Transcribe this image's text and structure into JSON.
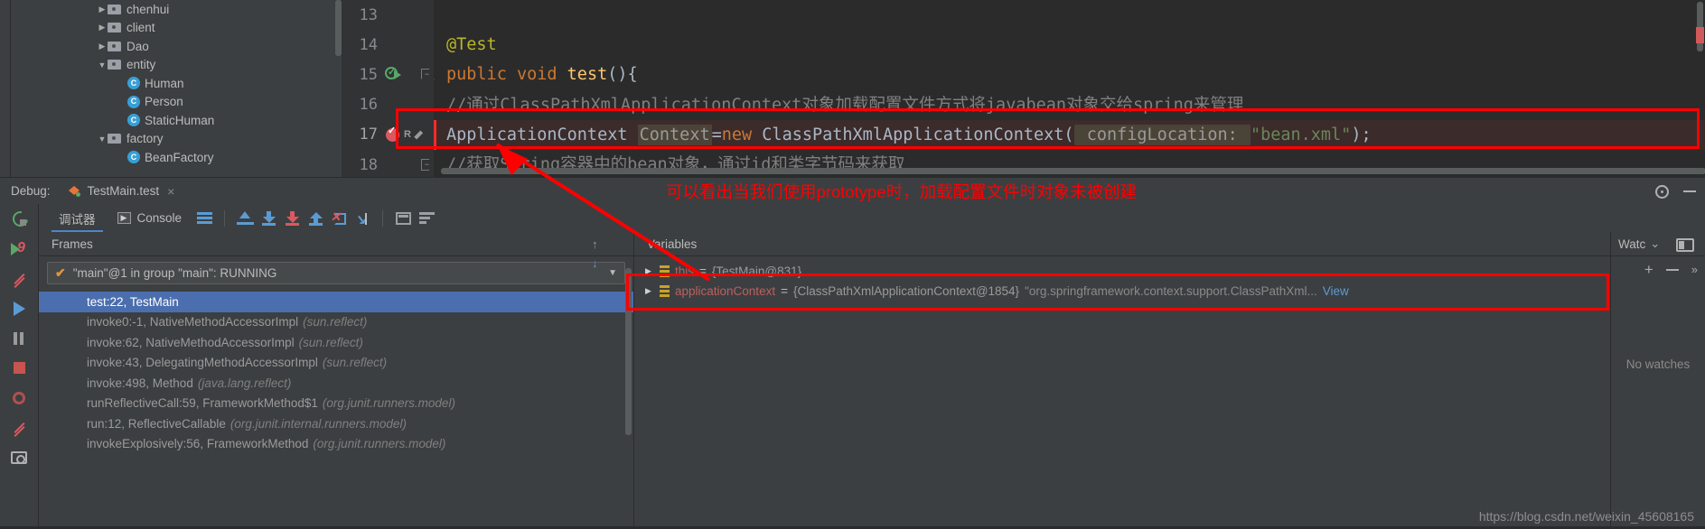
{
  "project_tree": {
    "items": [
      {
        "label": "chenhui",
        "type": "folder",
        "expanded": false,
        "indent": 0
      },
      {
        "label": "client",
        "type": "folder",
        "expanded": false,
        "indent": 0
      },
      {
        "label": "Dao",
        "type": "folder",
        "expanded": false,
        "indent": 0
      },
      {
        "label": "entity",
        "type": "folder",
        "expanded": true,
        "indent": 0
      },
      {
        "label": "Human",
        "type": "class",
        "expanded": null,
        "indent": 1
      },
      {
        "label": "Person",
        "type": "class",
        "expanded": null,
        "indent": 1
      },
      {
        "label": "StaticHuman",
        "type": "class",
        "expanded": null,
        "indent": 1
      },
      {
        "label": "factory",
        "type": "folder",
        "expanded": true,
        "indent": 0
      },
      {
        "label": "BeanFactory",
        "type": "class",
        "expanded": null,
        "indent": 1
      }
    ]
  },
  "editor": {
    "lines": [
      {
        "num": "13",
        "tokens": []
      },
      {
        "num": "14",
        "tokens": [
          {
            "t": "@Test",
            "c": "t-ann"
          }
        ]
      },
      {
        "num": "15",
        "tokens": [
          {
            "t": "public ",
            "c": "t-kw"
          },
          {
            "t": "void ",
            "c": "t-kw"
          },
          {
            "t": "test",
            "c": "t-method"
          },
          {
            "t": "(){",
            "c": "t-plain"
          }
        ]
      },
      {
        "num": "16",
        "tokens": [
          {
            "t": "    //通过ClassPathXmlApplicationContext对象加载配置文件方式将javabean对象交给spring来管理",
            "c": "t-comment"
          }
        ]
      },
      {
        "num": "17",
        "tokens": [
          {
            "t": "    ApplicationContext ",
            "c": "t-type"
          },
          {
            "t": "Context",
            "c": "t-ctxvar"
          },
          {
            "t": "=",
            "c": "t-plain"
          },
          {
            "t": "new ",
            "c": "t-kw"
          },
          {
            "t": "ClassPathXmlApplicationContext(",
            "c": "t-type"
          },
          {
            "t": " configLocation: ",
            "c": "t-param"
          },
          {
            "t": "\"bean.xml\"",
            "c": "t-str"
          },
          {
            "t": ");",
            "c": "t-plain"
          }
        ]
      },
      {
        "num": "18",
        "tokens": [
          {
            "t": "    //获取Spring容器中的bean对象，通过id和类字节码来获取",
            "c": "t-comment"
          }
        ]
      }
    ],
    "line15_gutter": "run-icon",
    "line17_gutter": "breakpoint-icon"
  },
  "debug_header": {
    "label": "Debug:",
    "tab_name": "TestMain.test",
    "close_glyph": "×"
  },
  "debug_toolbar": {
    "tabs": [
      {
        "label": "调试器",
        "active": true
      },
      {
        "label": "Console",
        "active": false
      }
    ]
  },
  "frames_panel": {
    "title": "Frames",
    "thread": "\"main\"@1 in group \"main\": RUNNING",
    "rows": [
      {
        "frame": "test:22, TestMain",
        "pkg": "",
        "selected": true
      },
      {
        "frame": "invoke0:-1, NativeMethodAccessorImpl",
        "pkg": "(sun.reflect)",
        "selected": false
      },
      {
        "frame": "invoke:62, NativeMethodAccessorImpl",
        "pkg": "(sun.reflect)",
        "selected": false
      },
      {
        "frame": "invoke:43, DelegatingMethodAccessorImpl",
        "pkg": "(sun.reflect)",
        "selected": false
      },
      {
        "frame": "invoke:498, Method",
        "pkg": "(java.lang.reflect)",
        "selected": false
      },
      {
        "frame": "runReflectiveCall:59, FrameworkMethod$1",
        "pkg": "(org.junit.runners.model)",
        "selected": false
      },
      {
        "frame": "run:12, ReflectiveCallable",
        "pkg": "(org.junit.internal.runners.model)",
        "selected": false
      },
      {
        "frame": "invokeExplosively:56, FrameworkMethod",
        "pkg": "(org.junit.runners.model)",
        "selected": false
      }
    ]
  },
  "variables_panel": {
    "title": "Variables",
    "rows": [
      {
        "name": "this",
        "eq": " = ",
        "value": "{TestMain@831}",
        "extra": "",
        "link": ""
      },
      {
        "name": "applicationContext",
        "eq": " = ",
        "value": "{ClassPathXmlApplicationContext@1854}",
        "extra": "\"org.springframework.context.support.ClassPathXml...",
        "link": "View"
      }
    ]
  },
  "watches_panel": {
    "title": "Watc",
    "empty_text": "No watches"
  },
  "annotations": {
    "note_text": "可以看出当我们使用prototype时，加载配置文件时对象未被创建",
    "color": "#ff0000"
  },
  "watermark": "https://blog.csdn.net/weixin_45608165"
}
